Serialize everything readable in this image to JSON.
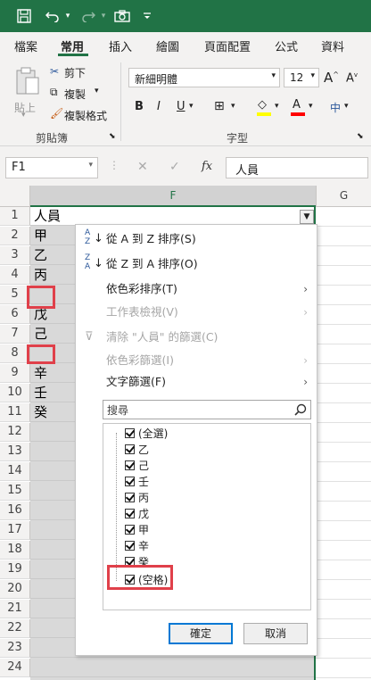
{
  "quick_access": {
    "save_icon": "save-icon",
    "undo_icon": "undo-icon",
    "redo_icon": "redo-icon",
    "camera_icon": "camera-icon",
    "customize_icon": "customize-icon"
  },
  "ribbon_tabs": [
    "檔案",
    "常用",
    "插入",
    "繪圖",
    "頁面配置",
    "公式",
    "資料"
  ],
  "active_tab": "常用",
  "clipboard": {
    "paste": "貼上",
    "cut": "剪下",
    "copy": "複製",
    "format_painter": "複製格式",
    "group_label": "剪貼簿"
  },
  "font": {
    "name": "新細明體",
    "size": "12",
    "group_label": "字型"
  },
  "formula_bar": {
    "name_box": "F1",
    "content": "人員"
  },
  "columns": {
    "f": "F",
    "g": "G"
  },
  "rows": [
    "1",
    "2",
    "3",
    "4",
    "5",
    "6",
    "7",
    "8",
    "9",
    "10",
    "11",
    "12",
    "13",
    "14",
    "15",
    "16",
    "17",
    "18",
    "19",
    "20",
    "21",
    "22",
    "23",
    "24"
  ],
  "cells": [
    "人員",
    "甲",
    "乙",
    "丙",
    "",
    "戊",
    "己",
    "",
    "辛",
    "壬",
    "癸"
  ],
  "filter_menu": {
    "sort_asc": "從 A 到 Z 排序(S)",
    "sort_desc": "從 Z 到 A 排序(O)",
    "sort_by_color": "依色彩排序(T)",
    "sheet_view": "工作表檢視(V)",
    "clear_filter": "清除 \"人員\" 的篩選(C)",
    "filter_by_color": "依色彩篩選(I)",
    "text_filters": "文字篩選(F)",
    "search_placeholder": "搜尋",
    "items": [
      "(全選)",
      "乙",
      "己",
      "壬",
      "丙",
      "戊",
      "甲",
      "辛",
      "癸",
      "(空格)"
    ],
    "ok": "確定",
    "cancel": "取消"
  },
  "colors": {
    "excel_green": "#217346",
    "highlight_red": "#e0404a",
    "primary_blue": "#0078d4"
  }
}
